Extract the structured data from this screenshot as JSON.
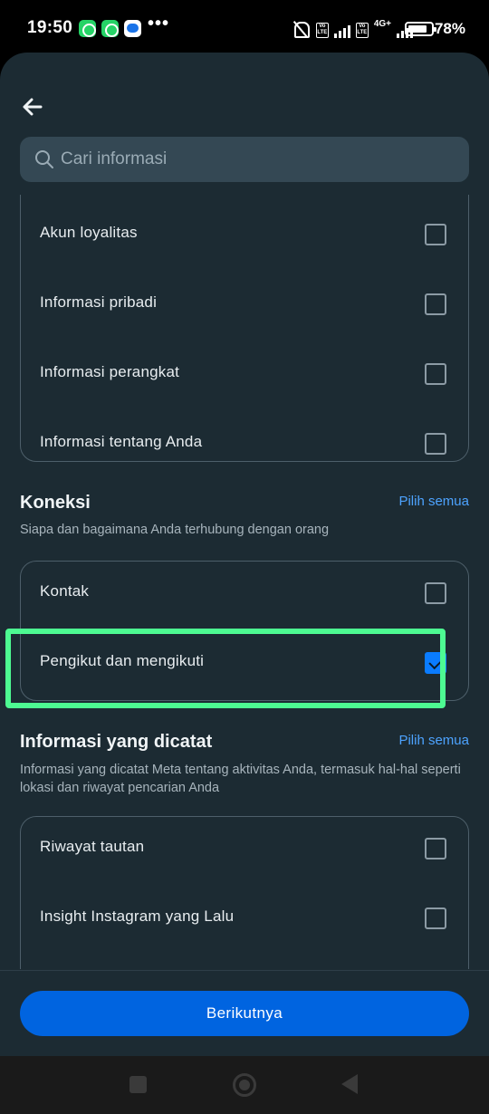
{
  "status_bar": {
    "time": "19:50",
    "more": "•••",
    "network": "4G+",
    "battery_percent": "78%",
    "battery_level": 0.78
  },
  "header": {
    "back_icon": "arrow-left-icon",
    "search_placeholder": "Cari informasi"
  },
  "sections": {
    "profile_items": [
      {
        "label": "Akun loyalitas",
        "checked": false
      },
      {
        "label": "Informasi pribadi",
        "checked": false
      },
      {
        "label": "Informasi perangkat",
        "checked": false
      },
      {
        "label": "Informasi tentang Anda",
        "checked": false
      }
    ],
    "connections": {
      "title": "Koneksi",
      "select_all": "Pilih semua",
      "description": "Siapa dan bagaimana Anda terhubung dengan orang",
      "items": [
        {
          "label": "Kontak",
          "checked": false
        },
        {
          "label": "Pengikut dan mengikuti",
          "checked": true
        }
      ]
    },
    "logged_info": {
      "title": "Informasi yang dicatat",
      "select_all": "Pilih semua",
      "description": "Informasi yang dicatat Meta tentang aktivitas Anda, termasuk hal-hal seperti lokasi dan riwayat pencarian Anda",
      "items": [
        {
          "label": "Riwayat tautan",
          "checked": false
        },
        {
          "label": "Insight Instagram yang Lalu",
          "checked": false
        }
      ]
    }
  },
  "footer": {
    "next_label": "Berikutnya"
  },
  "colors": {
    "background": "#1c2b33",
    "accent": "#0064e0",
    "link": "#4da3ff",
    "highlight": "#4dfa92"
  }
}
